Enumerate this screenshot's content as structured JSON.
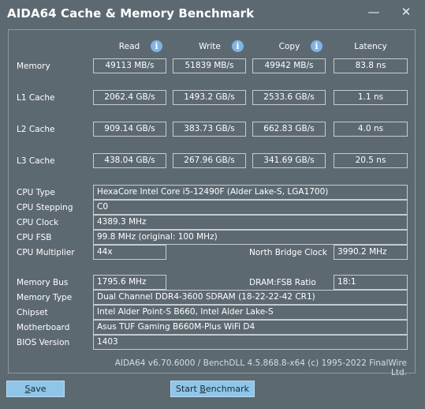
{
  "window": {
    "title": "AIDA64 Cache & Memory Benchmark",
    "minimize_icon": "minimize-icon",
    "close_icon": "close-icon"
  },
  "headers": {
    "read": "Read",
    "write": "Write",
    "copy": "Copy",
    "latency": "Latency",
    "info_glyph": "i"
  },
  "bench": [
    {
      "label": "Memory",
      "read": "49113 MB/s",
      "write": "51839 MB/s",
      "copy": "49942 MB/s",
      "latency": "83.8 ns"
    },
    {
      "label": "L1 Cache",
      "read": "2062.4 GB/s",
      "write": "1493.2 GB/s",
      "copy": "2533.6 GB/s",
      "latency": "1.1 ns"
    },
    {
      "label": "L2 Cache",
      "read": "909.14 GB/s",
      "write": "383.73 GB/s",
      "copy": "662.83 GB/s",
      "latency": "4.0 ns"
    },
    {
      "label": "L3 Cache",
      "read": "438.04 GB/s",
      "write": "267.96 GB/s",
      "copy": "341.69 GB/s",
      "latency": "20.5 ns"
    }
  ],
  "cpu": {
    "type_label": "CPU Type",
    "type_value": "HexaCore Intel Core i5-12490F  (Alder Lake-S, LGA1700)",
    "stepping_label": "CPU Stepping",
    "stepping_value": "C0",
    "clock_label": "CPU Clock",
    "clock_value": "4389.3 MHz",
    "fsb_label": "CPU FSB",
    "fsb_value": "99.8 MHz  (original: 100 MHz)",
    "multiplier_label": "CPU Multiplier",
    "multiplier_value": "44x",
    "nb_clock_label": "North Bridge Clock",
    "nb_clock_value": "3990.2 MHz"
  },
  "memory": {
    "bus_label": "Memory Bus",
    "bus_value": "1795.6 MHz",
    "ratio_label": "DRAM:FSB Ratio",
    "ratio_value": "18:1",
    "type_label": "Memory Type",
    "type_value": "Dual Channel DDR4-3600 SDRAM  (18-22-22-42 CR1)",
    "chipset_label": "Chipset",
    "chipset_value": "Intel Alder Point-S B660, Intel Alder Lake-S",
    "mobo_label": "Motherboard",
    "mobo_value": "Asus TUF Gaming B660M-Plus WiFi D4",
    "bios_label": "BIOS Version",
    "bios_value": "1403"
  },
  "footer": "AIDA64 v6.70.6000 / BenchDLL 4.5.868.8-x64  (c) 1995-2022 FinalWire Ltd.",
  "buttons": {
    "save_ul": "S",
    "save_rest": "ave",
    "start_a": "Start ",
    "start_ul": "B",
    "start_b": "enchmark"
  }
}
